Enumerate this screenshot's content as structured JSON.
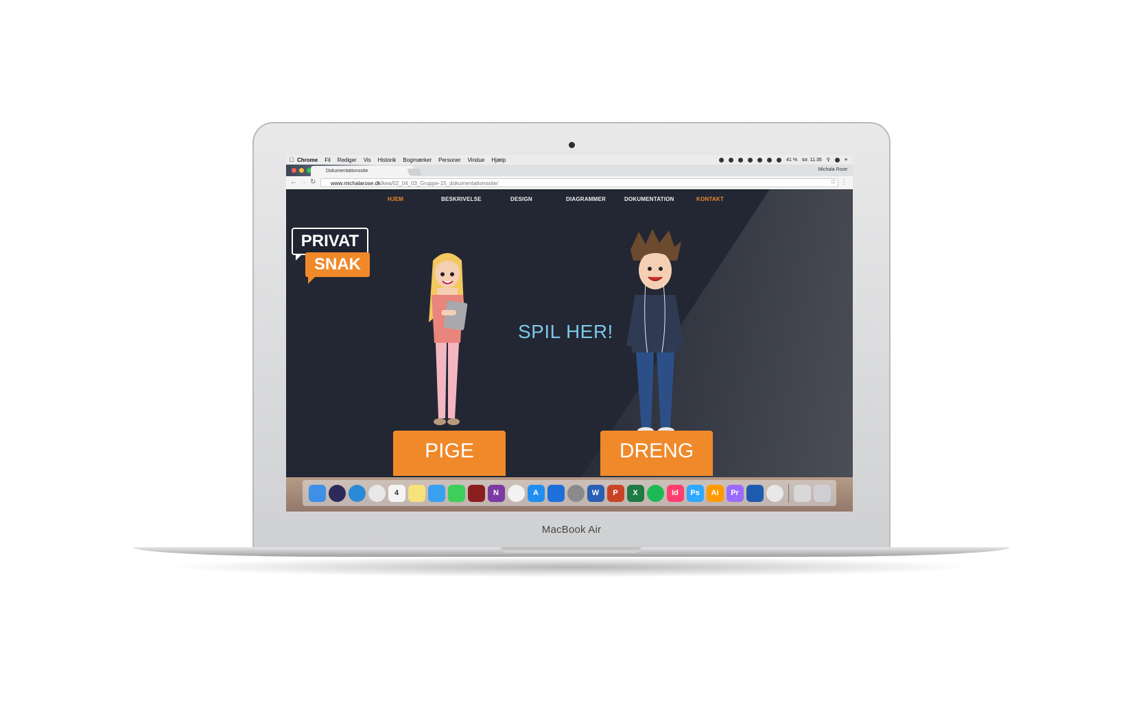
{
  "device": {
    "brand_label": "MacBook Air"
  },
  "menubar": {
    "app": "Chrome",
    "items": [
      "Fil",
      "Rediger",
      "Vis",
      "Historik",
      "Bogmærker",
      "Personer",
      "Vindue",
      "Hjælp"
    ],
    "battery": "41 %",
    "clock": "tor. 11.35"
  },
  "browser": {
    "tab_title": "Dokumentationssite",
    "profile_name": "Michala Rose",
    "url_domain": "www.michalarose.dk",
    "url_path": "/kea/02_04_03_Gruppe-15_dokumentationssite/"
  },
  "site": {
    "nav": [
      "HJEM",
      "BESKRIVELSE",
      "DESIGN",
      "DIAGRAMMER",
      "DOKUMENTATION",
      "KONTAKT"
    ],
    "logo_top": "PRIVAT",
    "logo_bottom": "SNAK",
    "headline": "SPIL HER!",
    "girl_button": "PIGE",
    "boy_button": "DRENG",
    "accent_color": "#f0892a",
    "background_color": "#232733"
  },
  "dock": {
    "apps": [
      {
        "icon": "finder-icon",
        "label": ""
      },
      {
        "icon": "siri-icon",
        "label": ""
      },
      {
        "icon": "safari-icon",
        "label": ""
      },
      {
        "icon": "chrome-icon",
        "label": ""
      },
      {
        "icon": "calendar-icon",
        "label": "4"
      },
      {
        "icon": "notes-icon",
        "label": ""
      },
      {
        "icon": "messages-icon",
        "label": ""
      },
      {
        "icon": "facetime-icon",
        "label": ""
      },
      {
        "icon": "photobooth-icon",
        "label": ""
      },
      {
        "icon": "onenote-icon",
        "label": "N"
      },
      {
        "icon": "photos-icon",
        "label": ""
      },
      {
        "icon": "appstore-icon",
        "label": "A"
      },
      {
        "icon": "dropbox-icon",
        "label": ""
      },
      {
        "icon": "preferences-icon",
        "label": ""
      },
      {
        "icon": "word-icon",
        "label": "W"
      },
      {
        "icon": "powerpoint-icon",
        "label": "P"
      },
      {
        "icon": "excel-icon",
        "label": "X"
      },
      {
        "icon": "spotify-icon",
        "label": ""
      },
      {
        "icon": "indesign-icon",
        "label": "Id"
      },
      {
        "icon": "photoshop-icon",
        "label": "Ps"
      },
      {
        "icon": "illustrator-icon",
        "label": "Ai"
      },
      {
        "icon": "premiere-icon",
        "label": "Pr"
      },
      {
        "icon": "screenshot-icon",
        "label": ""
      },
      {
        "icon": "chrome-icon",
        "label": ""
      },
      {
        "icon": "downloads-icon",
        "label": ""
      },
      {
        "icon": "trash-icon",
        "label": ""
      }
    ]
  }
}
